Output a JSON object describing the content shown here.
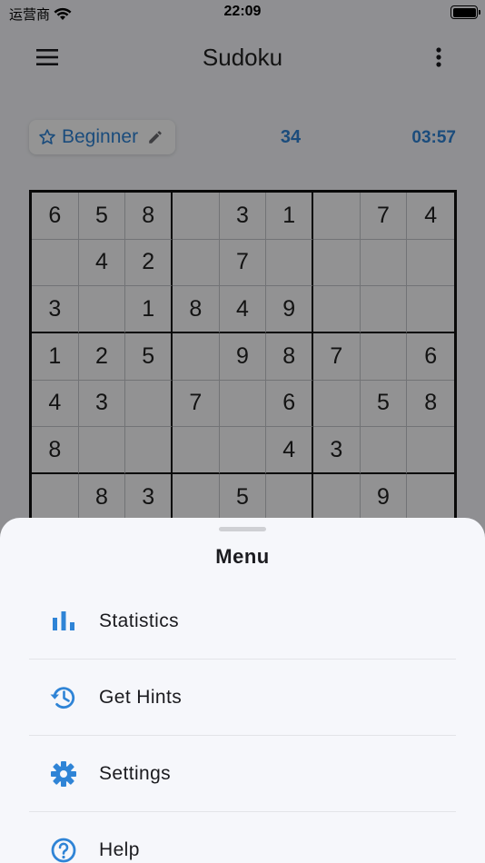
{
  "status_bar": {
    "carrier": "运营商",
    "time": "22:09"
  },
  "app_bar": {
    "title": "Sudoku"
  },
  "game_info": {
    "difficulty": "Beginner",
    "score": "34",
    "timer": "03:57"
  },
  "board": {
    "rows": [
      [
        "6",
        "5",
        "8",
        "",
        "3",
        "1",
        "",
        "7",
        "4"
      ],
      [
        "",
        "4",
        "2",
        "",
        "7",
        "",
        "",
        "",
        ""
      ],
      [
        "3",
        "",
        "1",
        "8",
        "4",
        "9",
        "",
        "",
        ""
      ],
      [
        "1",
        "2",
        "5",
        "",
        "9",
        "8",
        "7",
        "",
        "6"
      ],
      [
        "4",
        "3",
        "",
        "7",
        "",
        "6",
        "",
        "5",
        "8"
      ],
      [
        "8",
        "",
        "",
        "",
        "",
        "4",
        "3",
        "",
        ""
      ],
      [
        "",
        "8",
        "3",
        "",
        "5",
        "",
        "",
        "9",
        ""
      ],
      [
        "",
        "",
        "",
        "",
        "",
        "",
        "",
        "",
        ""
      ],
      [
        "",
        "",
        "",
        "",
        "",
        "",
        "",
        "",
        ""
      ]
    ]
  },
  "menu_sheet": {
    "title": "Menu",
    "items": [
      {
        "label": "Statistics",
        "icon": "bar-chart-icon"
      },
      {
        "label": "Get Hints",
        "icon": "history-icon"
      },
      {
        "label": "Settings",
        "icon": "gear-icon"
      },
      {
        "label": "Help",
        "icon": "help-icon"
      }
    ]
  },
  "colors": {
    "accent": "#2f84d6",
    "sheet_background": "#f6f7fb",
    "scrim": "rgba(0,0,0,0.42)"
  }
}
